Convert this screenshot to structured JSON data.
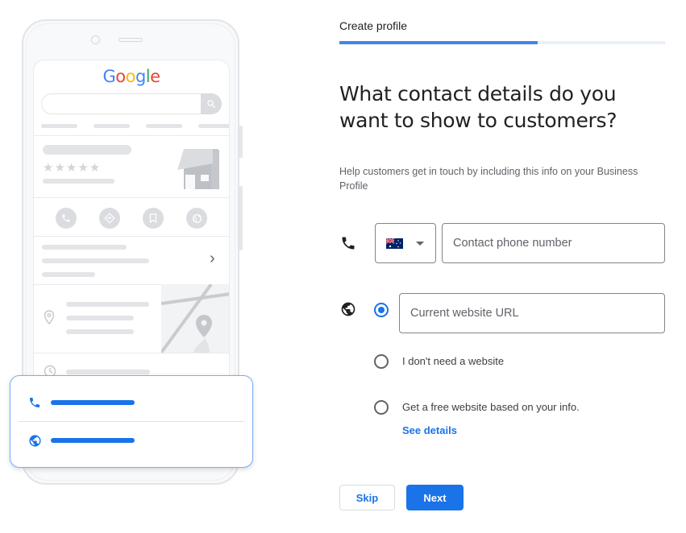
{
  "illustration": {
    "brand_logo": {
      "letters": [
        "G",
        "o",
        "o",
        "g",
        "l",
        "e"
      ],
      "colors": [
        "#4285f4",
        "#ea4335",
        "#fbbc05",
        "#4285f4",
        "#34a853",
        "#ea4335"
      ]
    },
    "stars": "★★★★★",
    "chevron": "›",
    "action_icons": [
      "phone-icon",
      "directions-icon",
      "bookmark-icon",
      "globe-icon"
    ],
    "card_icons": [
      "phone-icon",
      "globe-icon"
    ]
  },
  "header": {
    "step_label": "Create profile",
    "progress_percent": 61
  },
  "form": {
    "title": "What contact details do you want to show to customers?",
    "subtitle": "Help customers get in touch by including this info on your Business Profile",
    "phone": {
      "icon": "phone-icon",
      "country": "Australia",
      "country_flag": "AU",
      "placeholder": "Contact phone number",
      "value": ""
    },
    "website": {
      "icon": "globe-icon",
      "selected_option": "current_website",
      "options": [
        {
          "id": "current_website",
          "placeholder": "Current website URL",
          "value": "",
          "checked": true
        },
        {
          "id": "no_website",
          "label": "I don't need a website",
          "checked": false
        },
        {
          "id": "free_website",
          "label": "Get a free website based on your info.",
          "checked": false,
          "link": "See details"
        }
      ]
    }
  },
  "actions": {
    "skip_label": "Skip",
    "next_label": "Next"
  },
  "colors": {
    "accent": "#1a73e8",
    "progress_fill": "#4285f4",
    "progress_track": "#e8f0fe"
  }
}
